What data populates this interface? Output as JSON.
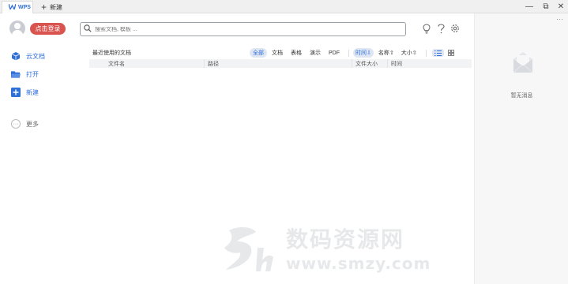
{
  "titlebar": {
    "wps_tab_label": "WPS",
    "new_tab_label": "新建",
    "new_tab_icon": "plus-icon",
    "controls": {
      "minimize": "—",
      "restore": "⧉",
      "close": "✕"
    }
  },
  "sidebar": {
    "login_label": "点击登录",
    "items": [
      {
        "label": "云文档",
        "icon": "cloud-doc-icon"
      },
      {
        "label": "打开",
        "icon": "folder-icon"
      },
      {
        "label": "新建",
        "icon": "new-doc-icon"
      }
    ],
    "more_label": "更多"
  },
  "search": {
    "placeholder": "搜索文档, 模板 ..."
  },
  "recent": {
    "title": "最近使用的文档",
    "filters": [
      "全部",
      "文档",
      "表格",
      "演示",
      "PDF"
    ],
    "active_filter": "全部",
    "sorts": [
      "时间⇩",
      "名称⇧",
      "大小⇧"
    ],
    "active_sort": "时间⇩",
    "columns": [
      "文件名",
      "路径",
      "文件大小",
      "时间"
    ]
  },
  "right_panel": {
    "more": "···",
    "empty_label": "暂无消息"
  },
  "watermark": {
    "cn": "数码资源网",
    "url": "www.smzy.com"
  },
  "colors": {
    "accent": "#2f6fd8",
    "login": "#d9534f"
  }
}
